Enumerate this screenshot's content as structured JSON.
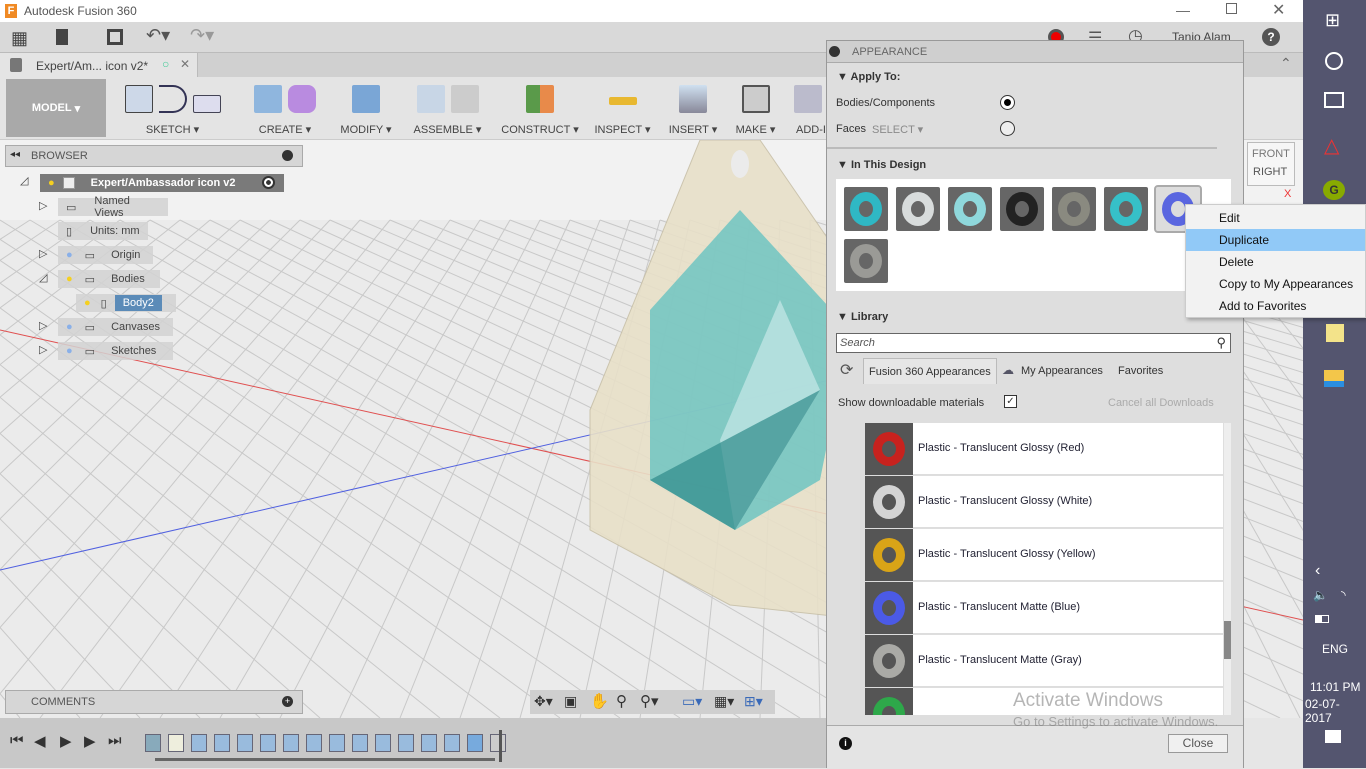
{
  "window": {
    "title": "Autodesk Fusion 360",
    "controls": [
      "minimize",
      "restore",
      "close"
    ]
  },
  "quick_access": {
    "user": "Tanio Alam",
    "icons": [
      "grid-icon",
      "file-icon",
      "save-icon",
      "undo-icon",
      "redo-icon",
      "record-icon",
      "jobs-icon",
      "clock-icon",
      "help-icon"
    ]
  },
  "doc_tab": {
    "label": "Expert/Am... icon v2*"
  },
  "toolbar": {
    "workspace": "MODEL",
    "groups": [
      "SKETCH",
      "CREATE",
      "MODIFY",
      "ASSEMBLE",
      "CONSTRUCT",
      "INSPECT",
      "INSERT",
      "MAKE",
      "ADD-I"
    ],
    "select": "SELECT"
  },
  "browser": {
    "title": "BROWSER",
    "root": "Expert/Ambassador icon v2",
    "items": [
      {
        "label": "Named Views"
      },
      {
        "label": "Units: mm"
      },
      {
        "label": "Origin"
      },
      {
        "label": "Bodies"
      },
      {
        "label": "Body2",
        "selected": true
      },
      {
        "label": "Canvases"
      },
      {
        "label": "Sketches"
      }
    ]
  },
  "comments": {
    "title": "COMMENTS"
  },
  "viewcube": {
    "face": "RIGHT",
    "front": "FRONT",
    "axis": "X"
  },
  "appearance": {
    "title": "APPEARANCE",
    "apply_to": {
      "heading": "Apply To:",
      "options": [
        {
          "label": "Bodies/Components",
          "checked": true
        },
        {
          "label": "Faces",
          "checked": false
        }
      ]
    },
    "in_design": {
      "heading": "In This Design",
      "swatches": [
        "#2fb8c4",
        "#d8dcdc",
        "#8fd8dc",
        "#222222",
        "#8a8a80",
        "#36c0c8",
        "#5a66e0",
        "#9a9a96"
      ],
      "selected_index": 6
    },
    "library": {
      "heading": "Library",
      "search_placeholder": "Search",
      "tabs": [
        "Fusion 360 Appearances",
        "My Appearances",
        "Favorites"
      ],
      "active_tab": 0,
      "show_downloadable": "Show downloadable materials",
      "show_downloadable_checked": true,
      "cancel_downloads": "Cancel all Downloads",
      "items": [
        {
          "name": "Plastic - Translucent Glossy (Red)",
          "color": "#c8221e"
        },
        {
          "name": "Plastic - Translucent Glossy (White)",
          "color": "#d4d4d4"
        },
        {
          "name": "Plastic - Translucent Glossy (Yellow)",
          "color": "#d9a417"
        },
        {
          "name": "Plastic - Translucent Matte (Blue)",
          "color": "#4b5ae6"
        },
        {
          "name": "Plastic - Translucent Matte (Gray)",
          "color": "#aaaaa6"
        },
        {
          "name": "",
          "color": "#2ea84a"
        }
      ]
    },
    "close": "Close"
  },
  "context_menu": {
    "items": [
      "Edit",
      "Duplicate",
      "Delete",
      "Copy to My Appearances",
      "Add to Favorites"
    ],
    "highlighted": 1
  },
  "watermark": {
    "line1": "Activate Windows",
    "line2": "Go to Settings to activate Windows."
  },
  "taskbar": {
    "time": "11:01 PM",
    "date": "02-07-2017",
    "lang": "ENG"
  }
}
